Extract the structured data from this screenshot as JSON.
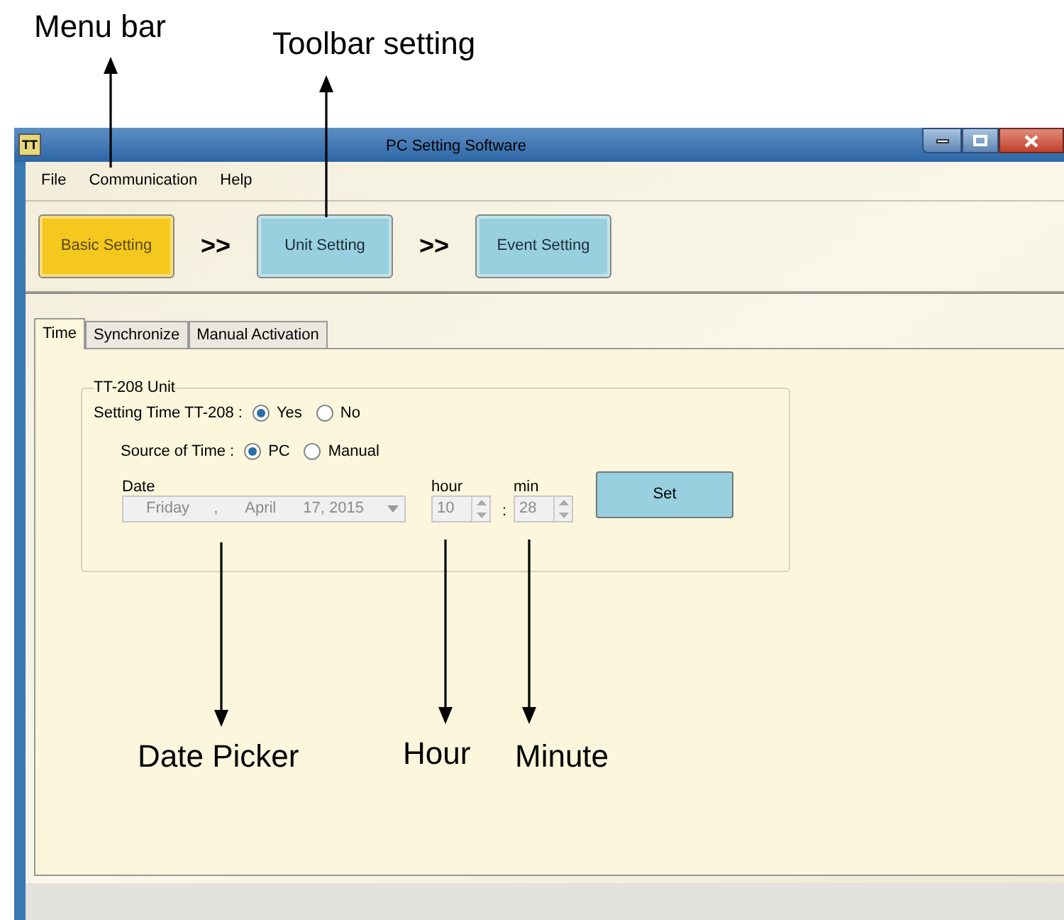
{
  "annotations": [
    {
      "label": "Menu bar"
    },
    {
      "label": "Toolbar setting"
    },
    {
      "label": "Date Picker"
    },
    {
      "label": "Hour"
    },
    {
      "label": "Minute"
    }
  ],
  "window": {
    "icon_text": "TT",
    "title": "PC Setting Software"
  },
  "menu": [
    "File",
    "Communication",
    "Help"
  ],
  "toolbar": {
    "steps": [
      {
        "label": "Basic Setting",
        "selected": true
      },
      {
        "label": "Unit Setting",
        "selected": false
      },
      {
        "label": "Event Setting",
        "selected": false
      }
    ],
    "separator": ">>"
  },
  "tabs": [
    {
      "label": "Time",
      "selected": true
    },
    {
      "label": "Synchronize",
      "selected": false
    },
    {
      "label": "Manual Activation",
      "selected": false
    }
  ],
  "group": {
    "title": "TT-208 Unit",
    "radio_rows": [
      {
        "label": "Setting Time TT-208 :",
        "options": [
          {
            "label": "Yes",
            "selected": true
          },
          {
            "label": "No",
            "selected": false
          }
        ]
      },
      {
        "label": "Source of Time :",
        "options": [
          {
            "label": "PC",
            "selected": true
          },
          {
            "label": "Manual",
            "selected": false
          }
        ]
      }
    ],
    "date": {
      "label": "Date",
      "parts": [
        "Friday",
        ",",
        "April",
        "17, 2015"
      ],
      "disabled": true
    },
    "hour": {
      "label": "hour",
      "value": "10",
      "disabled": true
    },
    "time_separator": ":",
    "minute": {
      "label": "min",
      "value": "28",
      "disabled": true
    },
    "button": "Set"
  }
}
